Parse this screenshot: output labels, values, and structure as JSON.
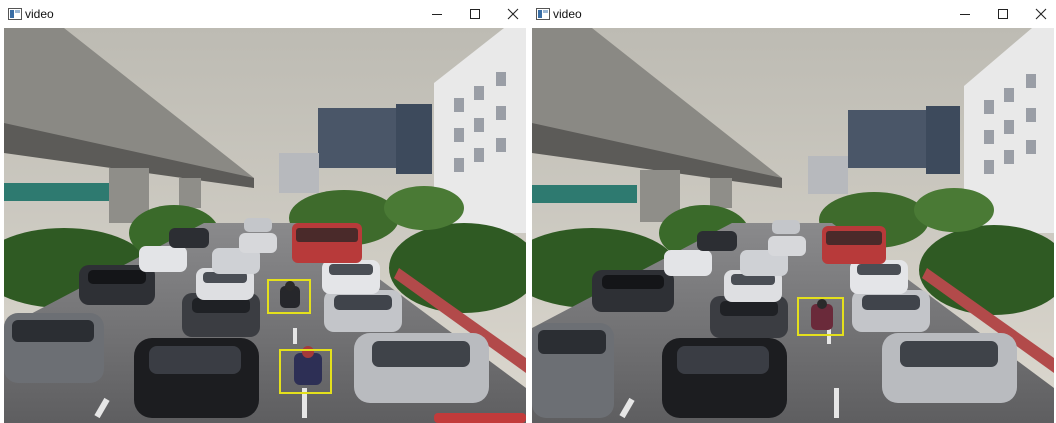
{
  "windows": [
    {
      "title": "video",
      "controls": [
        "minimize-icon",
        "maximize-icon",
        "close-icon"
      ],
      "detections": [
        {
          "label": "motorcycle-box"
        },
        {
          "label": "motorcycle-box"
        }
      ]
    },
    {
      "title": "video",
      "controls": [
        "minimize-icon",
        "maximize-icon",
        "close-icon"
      ],
      "detections": [
        {
          "label": "motorcycle-box"
        }
      ]
    }
  ],
  "colors": {
    "sky": "#cfcdc5",
    "road": "#6e6e70",
    "foliage": "#2f5a23",
    "bridge": "#7c7b77",
    "detection_box": "#e4e01c"
  }
}
